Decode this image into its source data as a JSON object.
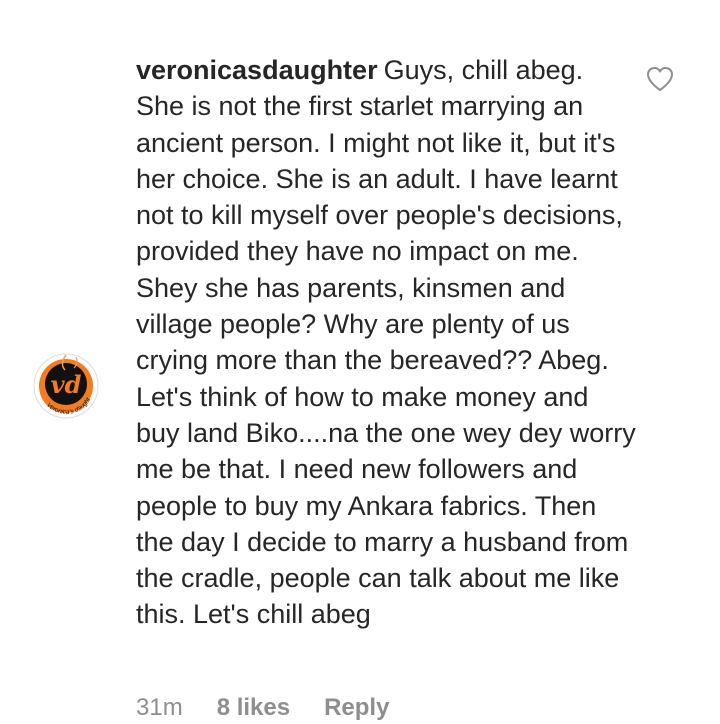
{
  "comment": {
    "username": "veronicasdaughter",
    "text": "Guys, chill abeg. She is not the first starlet marrying an ancient person. I might not like it, but it's her choice. She is an adult. I have learnt not to kill myself over people's decisions, provided they have no impact on me. Shey she has parents, kinsmen and village people? Why are plenty of us crying more than the bereaved?? Abeg. Let's think of how to make money and buy land Biko....na the one wey dey worry me be that. I need new followers and people to buy my Ankara fabrics. Then the day I decide to marry a husband from the cradle, people can talk about me like this. Let's chill abeg",
    "timestamp": "31m",
    "likes": "8 likes",
    "reply_label": "Reply",
    "avatar": {
      "monogram": "vd",
      "ring_text": "Veronica's daughter",
      "colors": {
        "ring": "#f47b20",
        "dark": "#111111"
      }
    },
    "like_icon": "heart-outline-icon"
  }
}
